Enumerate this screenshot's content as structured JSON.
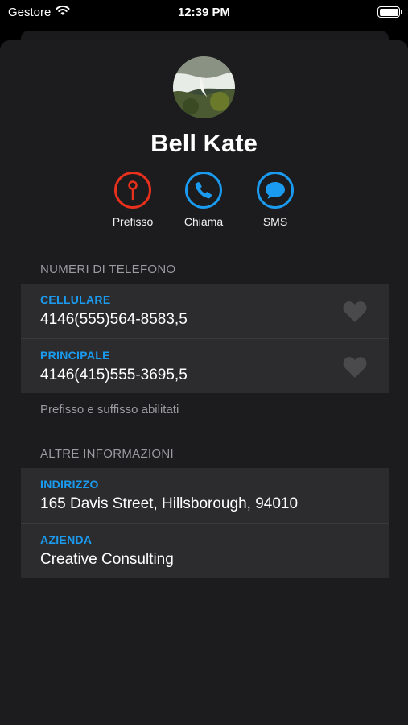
{
  "status_bar": {
    "carrier": "Gestore",
    "time": "12:39 PM"
  },
  "contact": {
    "name": "Bell Kate"
  },
  "actions": [
    {
      "label": "Prefisso",
      "icon": "pin-icon",
      "color": "#e8301c"
    },
    {
      "label": "Chiama",
      "icon": "phone-icon",
      "color": "#1a9bf0"
    },
    {
      "label": "SMS",
      "icon": "message-bubble-icon",
      "color": "#1a9bf0"
    }
  ],
  "phone_section": {
    "header": "NUMERI DI TELEFONO",
    "rows": [
      {
        "label": "CELLULARE",
        "value": "4146(555)564-8583,5"
      },
      {
        "label": "PRINCIPALE",
        "value": "4146(415)555-3695,5"
      }
    ],
    "footer": "Prefisso e suffisso abilitati"
  },
  "info_section": {
    "header": "ALTRE INFORMAZIONI",
    "rows": [
      {
        "label": "INDIRIZZO",
        "value": "165 Davis Street, Hillsborough, 94010"
      },
      {
        "label": "AZIENDA",
        "value": "Creative Consulting"
      }
    ]
  },
  "colors": {
    "accent": "#1a9bf0",
    "prefix_red": "#e8301c",
    "heart_gray": "#4a4a4c"
  }
}
